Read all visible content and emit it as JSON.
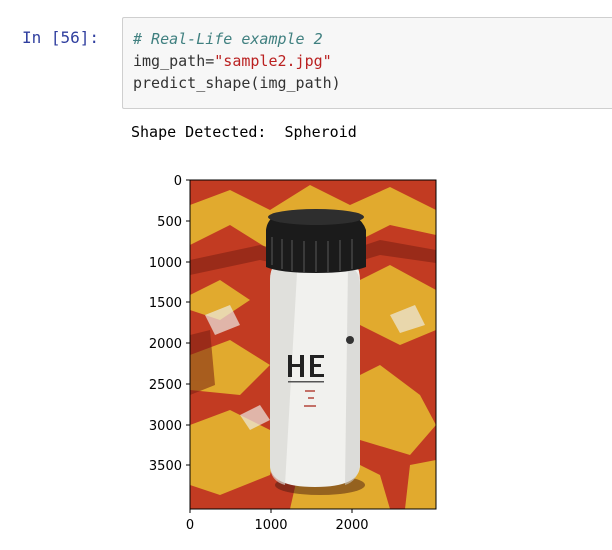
{
  "cell": {
    "prompt": "In [56]:",
    "code": [
      {
        "tokens": [
          {
            "cls": "cm-comment",
            "text": "# Real-Life example 2"
          }
        ]
      },
      {
        "tokens": [
          {
            "cls": "cm-variable",
            "text": "img_path"
          },
          {
            "cls": "cm-operator",
            "text": "="
          },
          {
            "cls": "cm-string",
            "text": "\"sample2.jpg\""
          }
        ]
      },
      {
        "tokens": [
          {
            "cls": "cm-variable",
            "text": "predict_shape(img_path)"
          }
        ]
      }
    ]
  },
  "output": {
    "text": "Shape Detected:  Spheroid"
  },
  "image_plot": {
    "x_ticks": [
      "0",
      "1000",
      "2000"
    ],
    "y_ticks": [
      "0",
      "500",
      "1000",
      "1500",
      "2000",
      "2500",
      "3000",
      "3500"
    ],
    "image_description_colors": {
      "background_red": "#c0392b",
      "background_yellow": "#e8b630",
      "bottle_white": "#f2f2f0",
      "cap_black": "#1a1a1a"
    }
  }
}
